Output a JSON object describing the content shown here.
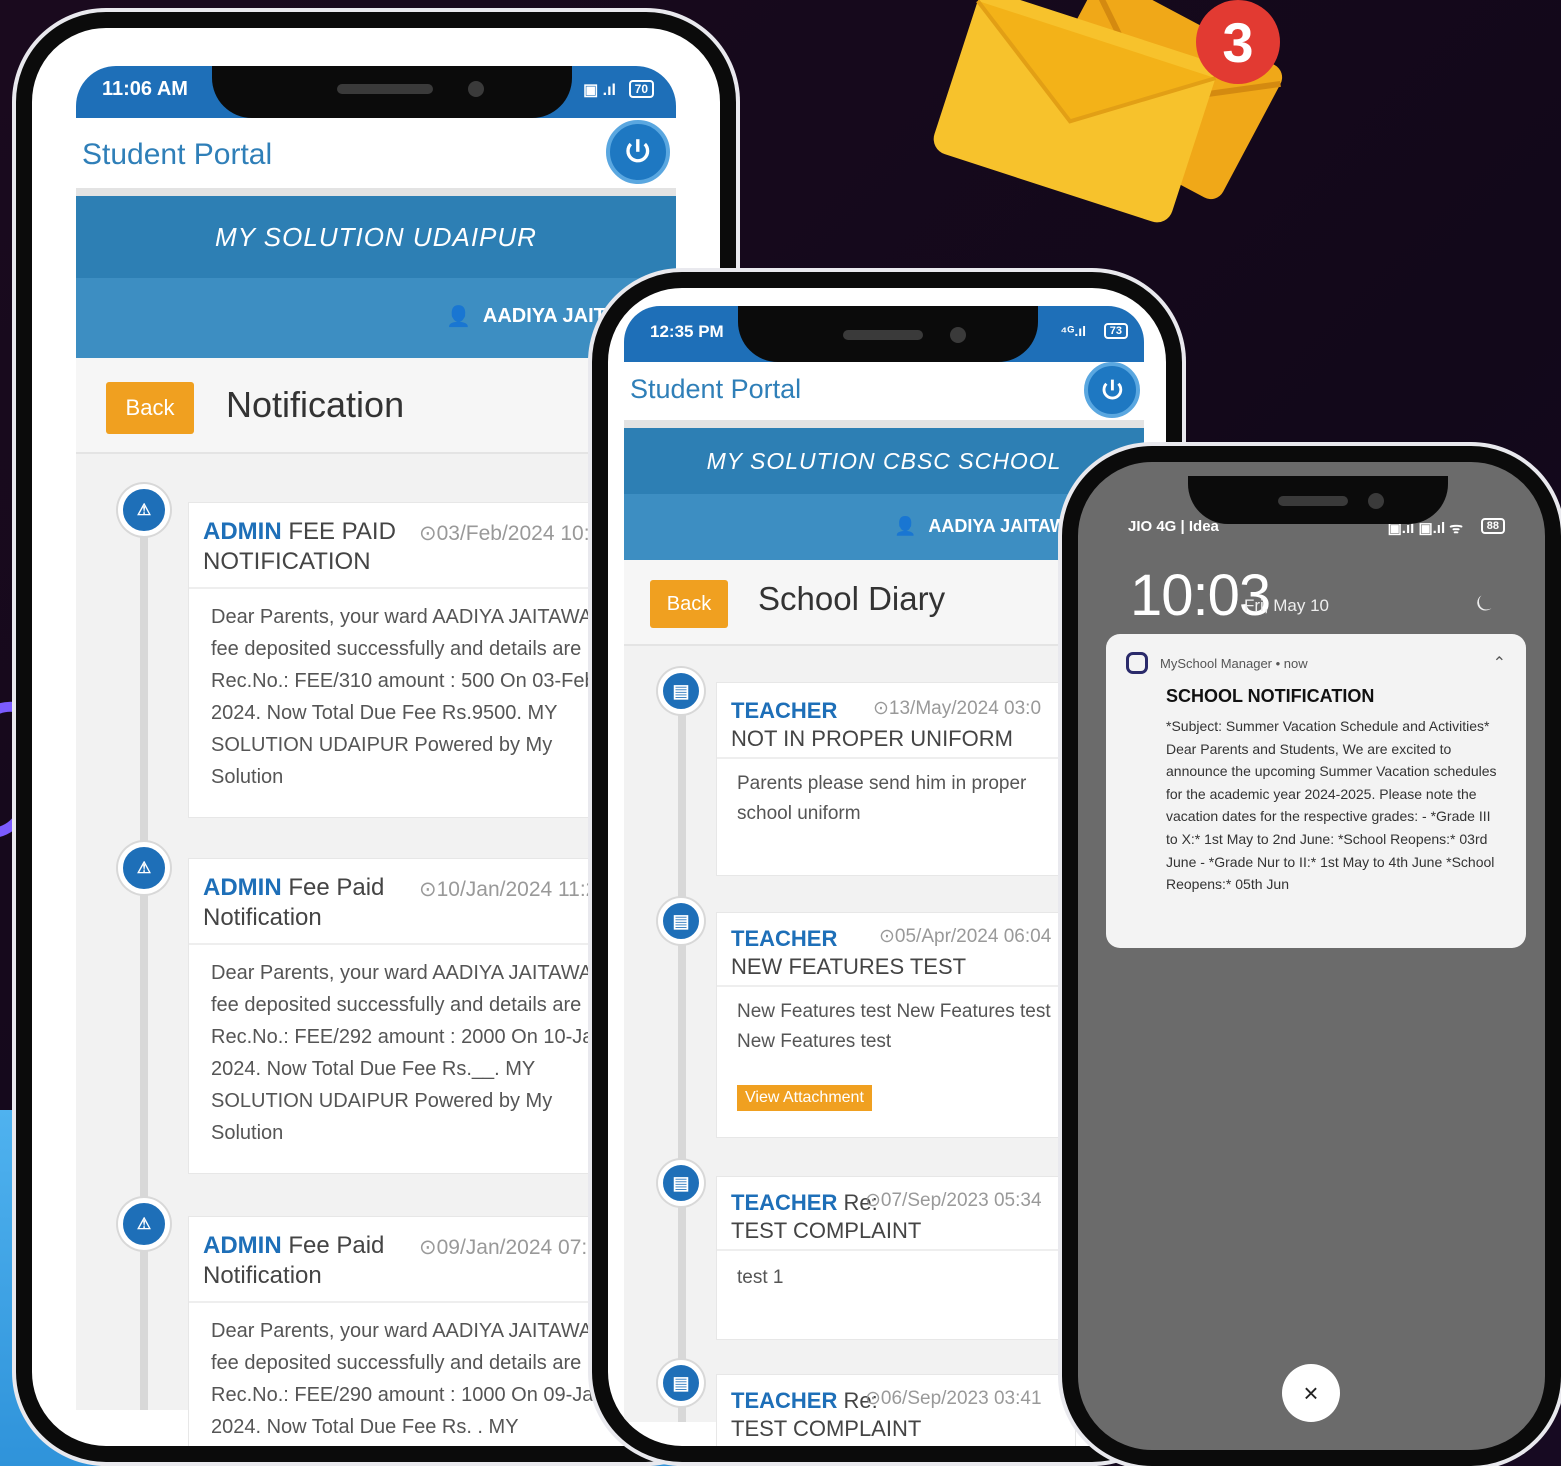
{
  "phone1": {
    "status_time": "11:06 AM",
    "status_icons": "▣ .ıl",
    "battery": "70",
    "app_title": "Student Portal",
    "school_name": "MY SOLUTION UDAIPUR",
    "user_name": "AADIYA JAITAW",
    "back_label": "Back",
    "page_title": "Notification",
    "items": [
      {
        "who": "ADMIN",
        "subject_line1": "FEE PAID",
        "subject_line2": "NOTIFICATION",
        "date": "⊙03/Feb/2024 10:3",
        "body": "Dear Parents, your ward AADIYA JAITAWAT fee deposited successfully and details are Rec.No.: FEE/310 amount : 500 On 03-Feb 2024. Now Total Due Fee Rs.9500. MY SOLUTION UDAIPUR Powered by My Solution"
      },
      {
        "who": "ADMIN",
        "subject_line1": "Fee Paid",
        "subject_line2": "Notification",
        "date": "⊙10/Jan/2024 11:2",
        "body": "Dear Parents, your ward AADIYA JAITAWAT fee deposited successfully and details are Rec.No.: FEE/292 amount : 2000 On 10-Jan 2024. Now Total Due Fee Rs.__. MY SOLUTION UDAIPUR Powered by My Solution"
      },
      {
        "who": "ADMIN",
        "subject_line1": "Fee Paid",
        "subject_line2": "Notification",
        "date": "⊙09/Jan/2024 07:0",
        "body": "Dear Parents, your ward AADIYA JAITAWAT fee deposited successfully and details are Rec.No.: FEE/290 amount : 1000 On 09-Jan 2024. Now Total Due Fee Rs. . MY"
      }
    ]
  },
  "phone2": {
    "status_time": "12:35 PM",
    "status_icons": "⁴ᴳ.ıl",
    "battery": "73",
    "app_title": "Student Portal",
    "school_name": "MY SOLUTION CBSC SCHOOL",
    "user_name": "AADIYA JAITAW",
    "back_label": "Back",
    "page_title": "School Diary",
    "attachment_label": "View Attachment",
    "items": [
      {
        "who": "TEACHER",
        "prefix": "",
        "subject": "NOT IN PROPER UNIFORM",
        "date": "⊙13/May/2024 03:0",
        "body": "Parents please send him in proper school uniform"
      },
      {
        "who": "TEACHER",
        "prefix": "",
        "subject": "NEW FEATURES TEST",
        "date": "⊙05/Apr/2024 06:04",
        "body": "New Features test New Features test New Features test"
      },
      {
        "who": "TEACHER",
        "prefix": "Re:",
        "subject": "TEST COMPLAINT",
        "date": "⊙07/Sep/2023 05:34",
        "body": "test 1"
      },
      {
        "who": "TEACHER",
        "prefix": "Re:",
        "subject": "TEST COMPLAINT",
        "date": "⊙06/Sep/2023 03:41",
        "body": ""
      }
    ]
  },
  "phone3": {
    "carrier": "JIO 4G | Idea",
    "status_icons": "▣.ıl ▣.ıl ᯤ",
    "battery": "88",
    "clock": "10:03",
    "date": "Fri, May 10",
    "notification": {
      "app": "MySchool Manager • now",
      "title": "SCHOOL NOTIFICATION",
      "body": "*Subject: Summer Vacation Schedule and Activities* Dear Parents and Students, We are excited to announce the upcoming Summer Vacation schedules for the academic year 2024-2025. Please note the vacation dates for the respective grades: - *Grade III to X:* 1st May to 2nd June: *School Reopens:* 03rd June - *Grade Nur to II:* 1st May to 4th June *School Reopens:* 05th Jun"
    },
    "close_glyph": "×"
  },
  "envelope_badge": "3",
  "colors": {
    "brand_blue": "#1e6fb8",
    "band_blue": "#2d7fb4",
    "orange": "#f0a020"
  }
}
